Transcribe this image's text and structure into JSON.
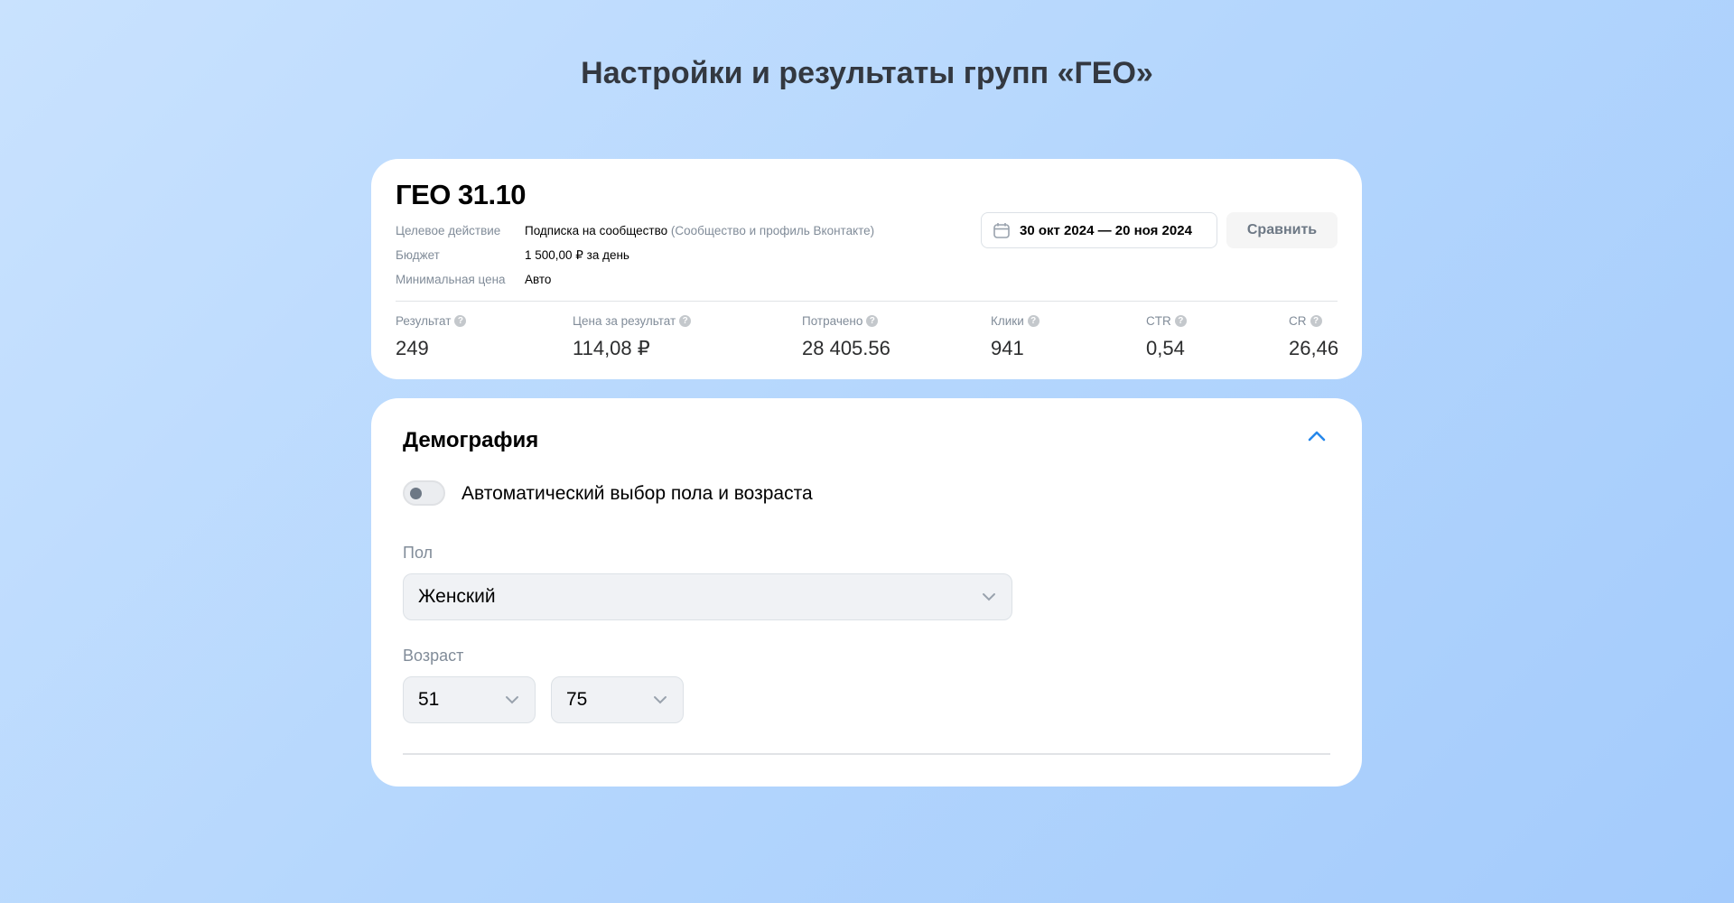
{
  "page_title": "Настройки и результаты групп «ГЕО»",
  "group": {
    "name": "ГЕО 31.10",
    "info": [
      {
        "label": "Целевое действие",
        "value": "Подписка на сообщество",
        "sub": "(Сообщество и профиль Вконтакте)"
      },
      {
        "label": "Бюджет",
        "value": "1 500,00 ₽ за день"
      },
      {
        "label": "Минимальная цена",
        "value": "Авто"
      }
    ],
    "date_range": "30 окт 2024 — 20 ноя 2024",
    "compare_label": "Сравнить",
    "metrics": [
      {
        "label": "Результат",
        "value": "249"
      },
      {
        "label": "Цена за результат",
        "value": "114,08 ₽"
      },
      {
        "label": "Потрачено",
        "value": "28 405.56"
      },
      {
        "label": "Клики",
        "value": "941"
      },
      {
        "label": "CTR",
        "value": "0,54"
      },
      {
        "label": "CR",
        "value": "26,46"
      }
    ],
    "help_glyph": "?"
  },
  "demography": {
    "title": "Демография",
    "auto_toggle_label": "Автоматический выбор пола и возраста",
    "auto_toggle_on": false,
    "gender_label": "Пол",
    "gender_value": "Женский",
    "age_label": "Возраст",
    "age_from": "51",
    "age_to": "75"
  },
  "colors": {
    "accent": "#2688eb"
  }
}
